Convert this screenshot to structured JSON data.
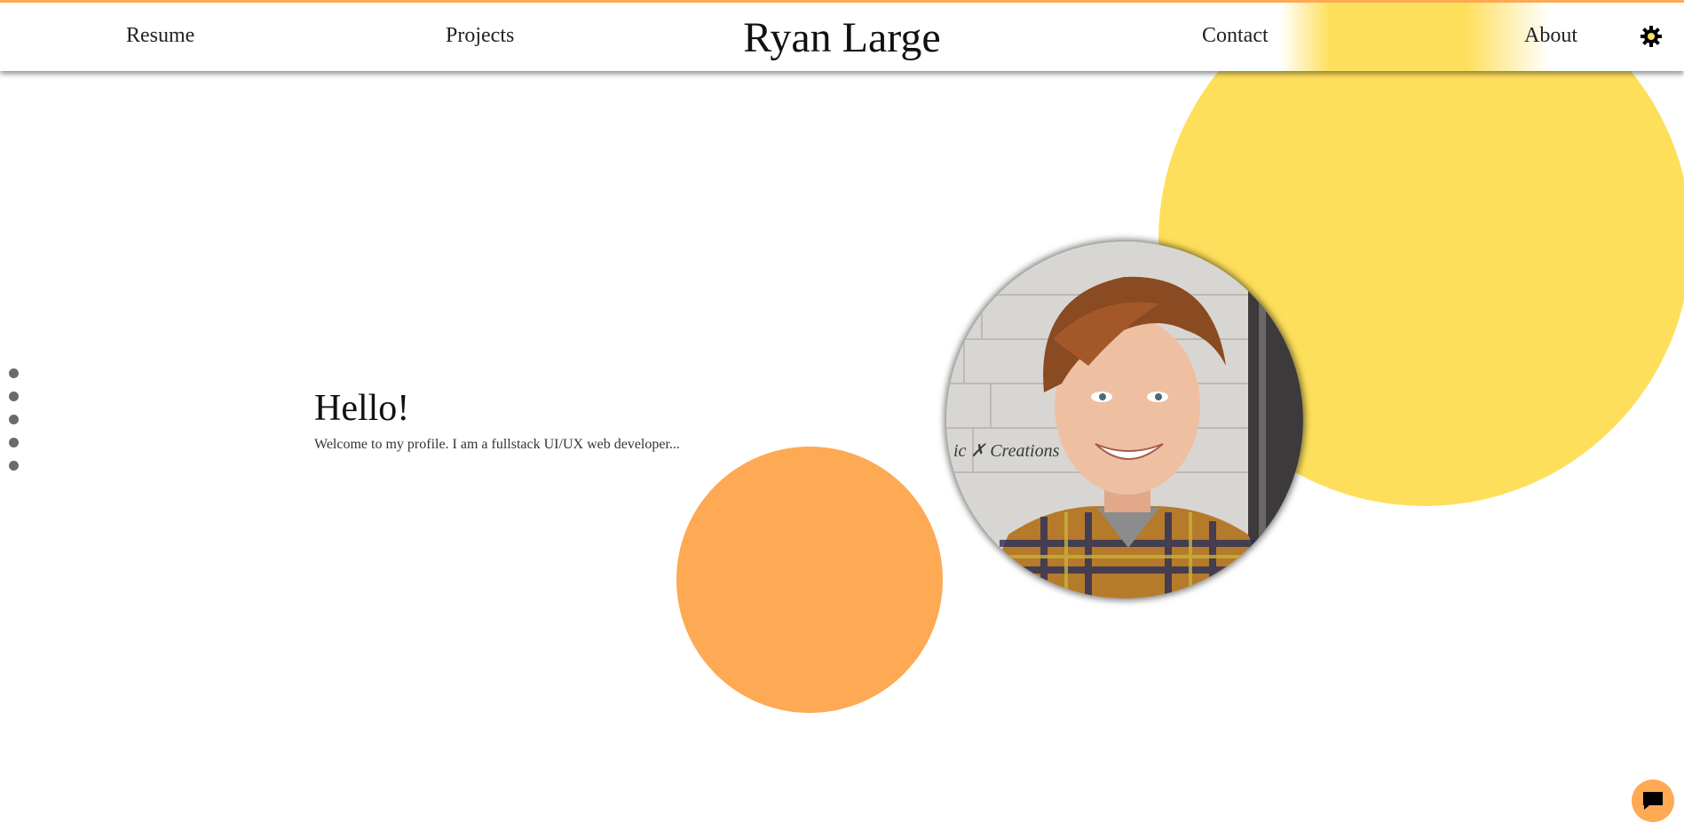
{
  "header": {
    "brand": "Ryan Large",
    "nav": {
      "resume": "Resume",
      "projects": "Projects",
      "contact": "Contact",
      "about": "About"
    },
    "theme_toggle_icon": "gear-icon"
  },
  "hero": {
    "title": "Hello!",
    "subtitle": "Welcome to my profile. I am a fullstack UI/UX web developer..."
  },
  "portrait": {
    "watermark": "ic ✗ Creations"
  },
  "side_nav": {
    "dot_count": 5
  },
  "chat": {
    "icon": "chat-bubble-icon"
  },
  "colors": {
    "accent_yellow": "#fedf5b",
    "accent_orange": "#fea953"
  }
}
